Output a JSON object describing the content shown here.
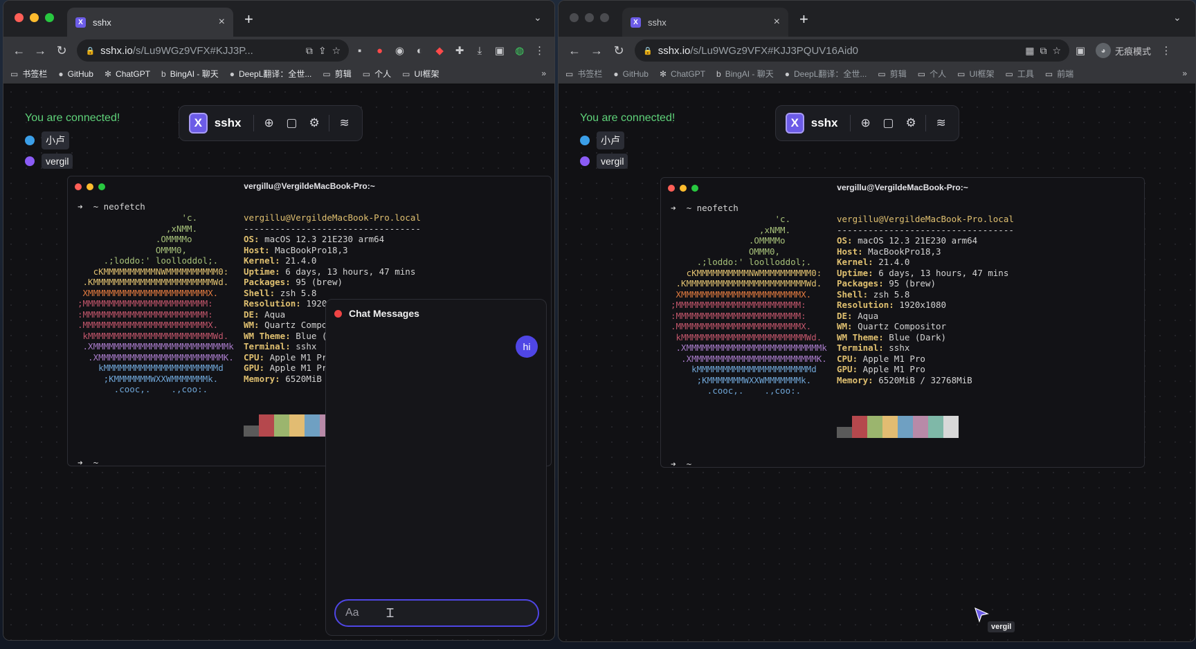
{
  "browser": {
    "tab_title": "sshx",
    "favicon_letter": "X",
    "new_tab_glyph": "+",
    "tab_close_glyph": "×",
    "tab_menu_glyph": "⌄",
    "url_left": {
      "host": "sshx.io",
      "path": "/s/Lu9WGz9VFX#KJJ3P..."
    },
    "url_right": {
      "host": "sshx.io",
      "path": "/s/Lu9WGz9VFX#KJJ3PQUV16Aid0"
    },
    "incognito_label": "无痕模式",
    "bookmarks_left": [
      "书签栏",
      "GitHub",
      "ChatGPT",
      "BingAI - 聊天",
      "DeepL翻译：全世...",
      "剪辑",
      "个人",
      "UI框架"
    ],
    "bookmarks_right": [
      "书签栏",
      "GitHub",
      "ChatGPT",
      "BingAI - 聊天",
      "DeepL翻译：全世...",
      "剪辑",
      "个人",
      "UI框架",
      "工具",
      "前端"
    ],
    "bookmarks_more": "»"
  },
  "sshx": {
    "status": "You are connected!",
    "app_name": "sshx",
    "logo_letter": "X",
    "users": [
      {
        "name": "小卢",
        "color": "#3b9fe8"
      },
      {
        "name": "vergil",
        "color": "#8b5cf6"
      }
    ]
  },
  "terminal": {
    "title": "vergillu@VergildeMacBook-Pro:~",
    "command_line": "➜  ~ neofetch",
    "final_prompt": "➜  ~",
    "ascii": [
      [
        "                    'c.",
        "a1"
      ],
      [
        "                 ,xNMM.",
        "a1"
      ],
      [
        "               .OMMMMo",
        "a1"
      ],
      [
        "               OMMM0,",
        "a1"
      ],
      [
        "     .;loddo:' loolloddol;.",
        "a1"
      ],
      [
        "   cKMMMMMMMMMMNWMMMMMMMMMM0:",
        "a2"
      ],
      [
        " .KMMMMMMMMMMMMMMMMMMMMMMMWd.",
        "a2"
      ],
      [
        " XMMMMMMMMMMMMMMMMMMMMMMMX.",
        "a3"
      ],
      [
        ";MMMMMMMMMMMMMMMMMMMMMMMM:",
        "a4"
      ],
      [
        ":MMMMMMMMMMMMMMMMMMMMMMMM:",
        "a4"
      ],
      [
        ".MMMMMMMMMMMMMMMMMMMMMMMMX.",
        "a4"
      ],
      [
        " kMMMMMMMMMMMMMMMMMMMMMMMMWd.",
        "a4"
      ],
      [
        " .XMMMMMMMMMMMMMMMMMMMMMMMMMMk",
        "a5"
      ],
      [
        "  .XMMMMMMMMMMMMMMMMMMMMMMMMK.",
        "a5"
      ],
      [
        "    kMMMMMMMMMMMMMMMMMMMMMMd",
        "a6"
      ],
      [
        "     ;KMMMMMMMWXXWMMMMMMMk.",
        "a6"
      ],
      [
        "       .cooc,.    .,coo:.",
        "a6"
      ]
    ],
    "user_host": "vergillu@VergildeMacBook-Pro.local",
    "divider": "----------------------------------",
    "info": [
      {
        "key": "OS",
        "value": "macOS 12.3 21E230 arm64"
      },
      {
        "key": "Host",
        "value": "MacBookPro18,3"
      },
      {
        "key": "Kernel",
        "value": "21.4.0"
      },
      {
        "key": "Uptime",
        "value": "6 days, 13 hours, 47 mins"
      },
      {
        "key": "Packages",
        "value": "95 (brew)"
      },
      {
        "key": "Shell",
        "value": "zsh 5.8"
      },
      {
        "key": "Resolution",
        "value": "1920x1080"
      },
      {
        "key": "DE",
        "value": "Aqua"
      },
      {
        "key": "WM",
        "value": "Quartz Compositor"
      },
      {
        "key": "WM Theme",
        "value": "Blue (Dark)"
      },
      {
        "key": "Terminal",
        "value": "sshx"
      },
      {
        "key": "CPU",
        "value": "Apple M1 Pro"
      },
      {
        "key": "GPU",
        "value": "Apple M1 Pro"
      },
      {
        "key": "Memory",
        "value": "6520MiB / 32768MiB"
      }
    ],
    "palette": [
      "#5a5a5a",
      "#b5484d",
      "#9bb56e",
      "#e2bc72",
      "#6fa0c2",
      "#b88aa8",
      "#7fb8a8",
      "#d8d8d8"
    ]
  },
  "chat": {
    "title": "Chat Messages",
    "message": "hi",
    "input_placeholder": "Aa"
  },
  "remote_cursor": {
    "name": "vergil"
  },
  "colors": {
    "accent": "#6c5ce7",
    "connected": "#5fd37a",
    "chat_accent": "#4f46e5"
  }
}
